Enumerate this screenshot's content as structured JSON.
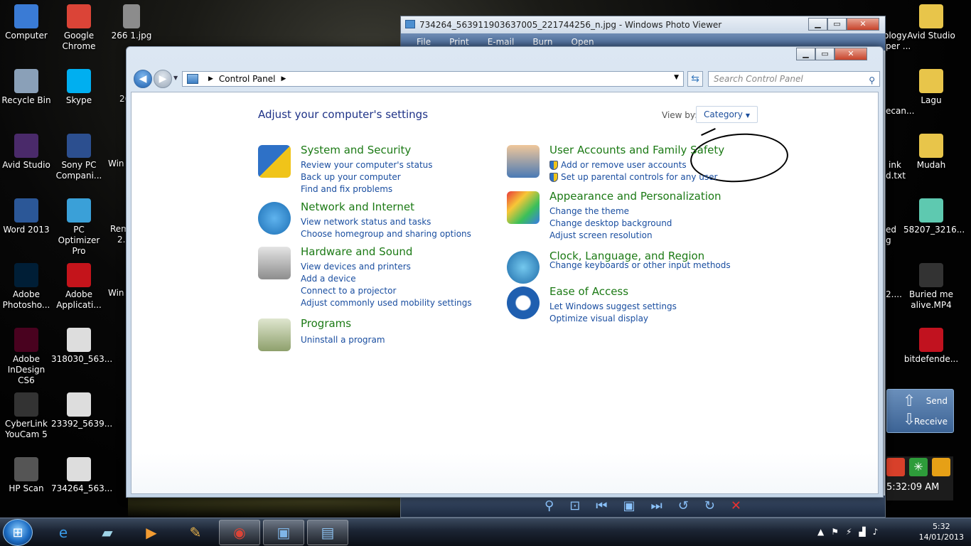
{
  "desktop": {
    "icons_left": [
      {
        "label": "Computer",
        "icon": "computer-icon",
        "color": "#3a7bd5"
      },
      {
        "label": "Recycle Bin",
        "icon": "recycle-bin-icon",
        "color": "#8aa0b8"
      },
      {
        "label": "Avid Studio",
        "icon": "avid-studio-icon",
        "color": "#4a2a6a"
      },
      {
        "label": "Word 2013",
        "icon": "word-icon",
        "color": "#2b5797"
      },
      {
        "label": "Adobe Photosho...",
        "icon": "photoshop-icon",
        "color": "#001e36"
      },
      {
        "label": "Adobe InDesign CS6",
        "icon": "indesign-icon",
        "color": "#49021f"
      },
      {
        "label": "CyberLink YouCam 5",
        "icon": "youcam-icon",
        "color": "#333"
      },
      {
        "label": "HP Scan",
        "icon": "hp-scan-icon",
        "color": "#555"
      }
    ],
    "icons_col2": [
      {
        "label": "Google Chrome",
        "icon": "chrome-icon",
        "color": "#db4437"
      },
      {
        "label": "Skype",
        "icon": "skype-icon",
        "color": "#00aff0"
      },
      {
        "label": "Sony PC Compani...",
        "icon": "sony-pc-companion-icon",
        "color": "#2c4f8f"
      },
      {
        "label": "PC Optimizer Pro",
        "icon": "pc-optimizer-icon",
        "color": "#3aa0d8"
      },
      {
        "label": "Adobe Applicati...",
        "icon": "adobe-application-icon",
        "color": "#c4141b"
      },
      {
        "label": "318030_563...",
        "icon": "image-file-icon",
        "color": "#ddd"
      },
      {
        "label": "23392_5639...",
        "icon": "image-file-icon",
        "color": "#ddd"
      },
      {
        "label": "734264_563...",
        "icon": "image-file-icon",
        "color": "#ddd"
      }
    ],
    "col3_label": "266 1.jpg",
    "col3_partials": [
      "26",
      "Win",
      "Rem",
      "2.",
      "Win"
    ],
    "icons_right": [
      {
        "label": "Avid Studio",
        "icon": "folder-icon",
        "color": "#e8c54a"
      },
      {
        "label": "Lagu",
        "icon": "folder-icon",
        "color": "#e8c54a"
      },
      {
        "label": "Mudah",
        "icon": "folder-icon",
        "color": "#e8c54a"
      },
      {
        "label": "58207_3216...",
        "icon": "image-file-icon",
        "color": "#5ec9b0"
      },
      {
        "label": "Buried me alive.MP4",
        "icon": "video-file-icon",
        "color": "#333"
      },
      {
        "label": "bitdefende...",
        "icon": "bitdefender-icon",
        "color": "#c1121f"
      }
    ],
    "right_partials": [
      "ology",
      "per ...",
      "ecan...",
      "ink",
      "d.txt",
      "ed",
      "g",
      "2...."
    ]
  },
  "photo_viewer": {
    "title": "734264_563911903637005_221744256_n.jpg - Windows Photo Viewer",
    "menu": [
      "File",
      "Print",
      "E-mail",
      "Burn",
      "Open"
    ]
  },
  "control_panel": {
    "breadcrumb": "Control Panel",
    "search_placeholder": "Search Control Panel",
    "heading": "Adjust your computer's settings",
    "view_by_label": "View by:",
    "view_by_value": "Category",
    "categories": [
      {
        "title": "System and Security",
        "icon": "shield-icon",
        "links": [
          "Review your computer's status",
          "Back up your computer",
          "Find and fix problems"
        ]
      },
      {
        "title": "Network and Internet",
        "icon": "network-icon",
        "links": [
          "View network status and tasks",
          "Choose homegroup and sharing options"
        ]
      },
      {
        "title": "Hardware and Sound",
        "icon": "printer-icon",
        "links": [
          "View devices and printers",
          "Add a device",
          "Connect to a projector",
          "Adjust commonly used mobility settings"
        ]
      },
      {
        "title": "Programs",
        "icon": "programs-icon",
        "links": [
          "Uninstall a program"
        ]
      },
      {
        "title": "User Accounts and Family Safety",
        "icon": "users-icon",
        "links": [
          "Add or remove user accounts",
          "Set up parental controls for any user"
        ]
      },
      {
        "title": "Appearance and Personalization",
        "icon": "appearance-icon",
        "links": [
          "Change the theme",
          "Change desktop background",
          "Adjust screen resolution"
        ]
      },
      {
        "title": "Clock, Language, and Region",
        "icon": "globe-clock-icon",
        "links": [
          "Change keyboards or other input methods"
        ]
      },
      {
        "title": "Ease of Access",
        "icon": "ease-of-access-icon",
        "links": [
          "Let Windows suggest settings",
          "Optimize visual display"
        ]
      }
    ]
  },
  "gadgets": {
    "send": "Send",
    "receive": "Receive",
    "clock": "5:32:09 AM"
  },
  "taskbar": {
    "time": "5:32",
    "date": "14/01/2013"
  }
}
